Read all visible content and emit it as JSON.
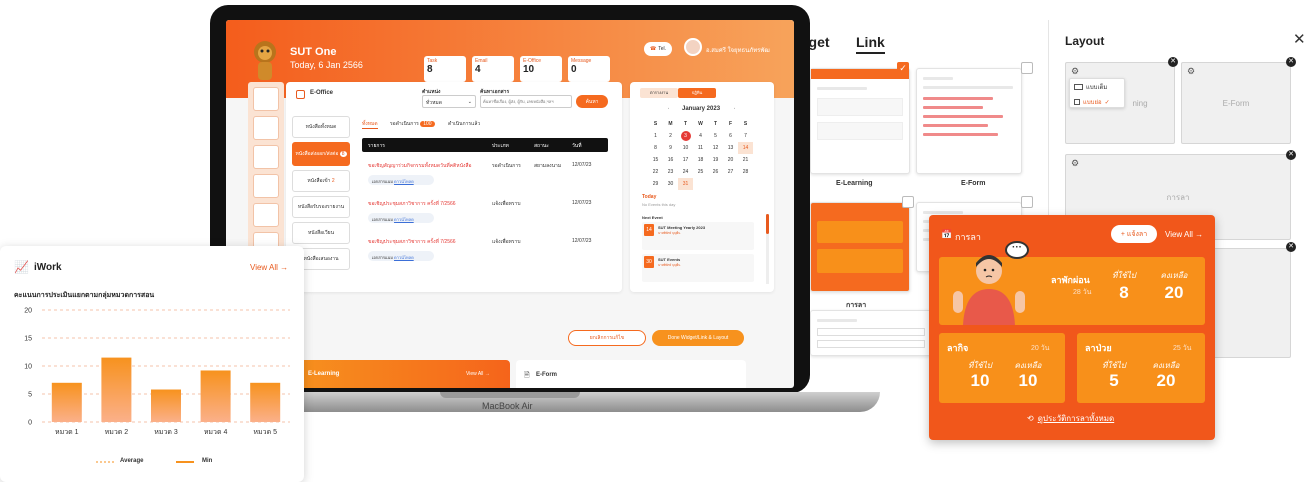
{
  "widget_panel": {
    "tabs": [
      "dget",
      "Link"
    ],
    "elearning_label": "E-Learning",
    "eform_label": "E-Form",
    "leave_label": "การลา"
  },
  "layout_panel": {
    "title": "Layout",
    "close_icon": "close-icon",
    "dropdown_items": [
      "แบบเต็ม",
      "แบบย่อ"
    ],
    "slot_labels": [
      "ning",
      "E-Form",
      "การลา"
    ]
  },
  "laptop": {
    "brand": "MacBook Air",
    "app_title": "SUT One",
    "date": "Today, 6 Jan 2566",
    "tel_label": "Tel.",
    "user_name": "อ.สมศรี ใจยุทธนภัทรพัฒ",
    "stats": [
      {
        "label": "Task",
        "value": "8"
      },
      {
        "label": "Email",
        "value": "4"
      },
      {
        "label": "E-Office",
        "value": "10"
      },
      {
        "label": "Message",
        "value": "0"
      }
    ],
    "eoffice": {
      "title": "E-Office",
      "position_label": "ตำแหน่ง",
      "position_value": "ทั่วหมด",
      "search_label": "ค้นหาเอกสาร",
      "search_placeholder": "ค้นหาชื่อเรื่อง, ผู้ส่ง, ผู้รับ, เลขหนังสือ,ฯลฯ",
      "search_button": "ค้นหา",
      "menu": [
        "หนังสือทั้งหมด",
        "หนังสือส่งออก/ส่งต่อ",
        "หนังสือเข้า",
        "หนังสือรับรองรายงาน",
        "หนังสือเวียน",
        "หนังสือเสนองาน"
      ],
      "menu_badges": [
        "",
        "8",
        "2",
        "",
        "",
        ""
      ],
      "tabs": [
        "ทั้งหมด",
        "รอดำเนินการ",
        "ดำเนินการแล้ว"
      ],
      "tab_badge": "100",
      "columns": [
        "รายการ",
        "ประเภท",
        "สถานะ",
        "วันที่"
      ],
      "rows": [
        {
          "title": "ขอเชิญสัญญาร่วมกิจกรรมทั้งหมดวันที่คติหนังสือ",
          "type": "รอดำเนินการ",
          "status": "สยามลงนาม",
          "date": "12/07/23",
          "attach": "เอกสารแนบ",
          "link": "ดาวน์โหลด"
        },
        {
          "title": "ขอเชิญประชุมสภาวิชาการ ครั้งที่ 7/2566",
          "type": "แจ้งเพื่อทราบ",
          "status": "",
          "date": "12/07/23",
          "attach": "เอกสารแนบ",
          "link": "ดาวน์โหลด"
        },
        {
          "title": "ขอเชิญประชุมสภาวิชาการ ครั้งที่ 7/2566",
          "type": "แจ้งเพื่อทราบ",
          "status": "",
          "date": "12/07/23",
          "attach": "เอกสารแนบ",
          "link": "ดาวน์โหลด"
        }
      ]
    },
    "calendar": {
      "tabs": [
        "ตารางงาน",
        "ปฏิทิน"
      ],
      "month": "January 2023",
      "weekdays": [
        "S",
        "M",
        "T",
        "W",
        "T",
        "F",
        "S"
      ],
      "weeks": [
        [
          "1",
          "2",
          "3",
          "4",
          "5",
          "6",
          "7"
        ],
        [
          "8",
          "9",
          "10",
          "11",
          "12",
          "13",
          "14"
        ],
        [
          "15",
          "16",
          "17",
          "18",
          "19",
          "20",
          "21"
        ],
        [
          "22",
          "23",
          "24",
          "25",
          "26",
          "27",
          "28"
        ],
        [
          "29",
          "30",
          "31",
          "",
          "",
          "",
          ""
        ]
      ],
      "today_label": "Today",
      "today_sub": "No Events this day",
      "next_label": "Next Event",
      "events": [
        {
          "day": "14",
          "title": "SUT Meeting Yearly 2023",
          "sub": "นายพิทักษ์ บุญยืน"
        },
        {
          "day": "30",
          "title": "SUT Events",
          "sub": "นายพิทักษ์ บุญยืน"
        }
      ]
    },
    "buttons": {
      "cancel": "ยกเลิกการแก้ไข",
      "done": "Done Widget/Link & Layout"
    },
    "bottom": {
      "elearning": "E-Learning",
      "view_all": "View All →",
      "eform": "E-Form"
    }
  },
  "iwork": {
    "title": "iWork",
    "view_all": "View All →",
    "subtitle": "คะแนนการประเมินแยกตามกลุ่มหมวดการสอน",
    "legend": [
      "Average",
      "Min"
    ]
  },
  "chart_data": {
    "type": "bar",
    "categories": [
      "หมวด 1",
      "หมวด 2",
      "หมวด 3",
      "หมวด 4",
      "หมวด 5"
    ],
    "values": [
      7,
      11.5,
      5.8,
      9.2,
      7
    ],
    "ylim": [
      0,
      20
    ],
    "yticks": [
      0,
      5,
      10,
      15,
      20
    ],
    "grid": true,
    "legend_placement": "bottom",
    "colors": {
      "bar_top": "#f7921e",
      "bar_bottom": "#fbb08a",
      "grid": "#f4b090"
    }
  },
  "leave": {
    "title": "การลา",
    "add_button": "+ แจ้งลา",
    "view_all": "View All →",
    "vacation": {
      "name": "ลาพักผ่อน",
      "days": "28 วัน",
      "used_label": "ที่ใช้ไป",
      "used": "8",
      "left_label": "คงเหลือ",
      "left": "20"
    },
    "personal": {
      "name": "ลากิจ",
      "days": "20 วัน",
      "used_label": "ที่ใช้ไป",
      "used": "10",
      "left_label": "คงเหลือ",
      "left": "10"
    },
    "sick": {
      "name": "ลาป่วย",
      "days": "25 วัน",
      "used_label": "ที่ใช้ไป",
      "used": "5",
      "left_label": "คงเหลือ",
      "left": "20"
    },
    "history_link": "ดูประวัติการลาทั้งหมด"
  }
}
